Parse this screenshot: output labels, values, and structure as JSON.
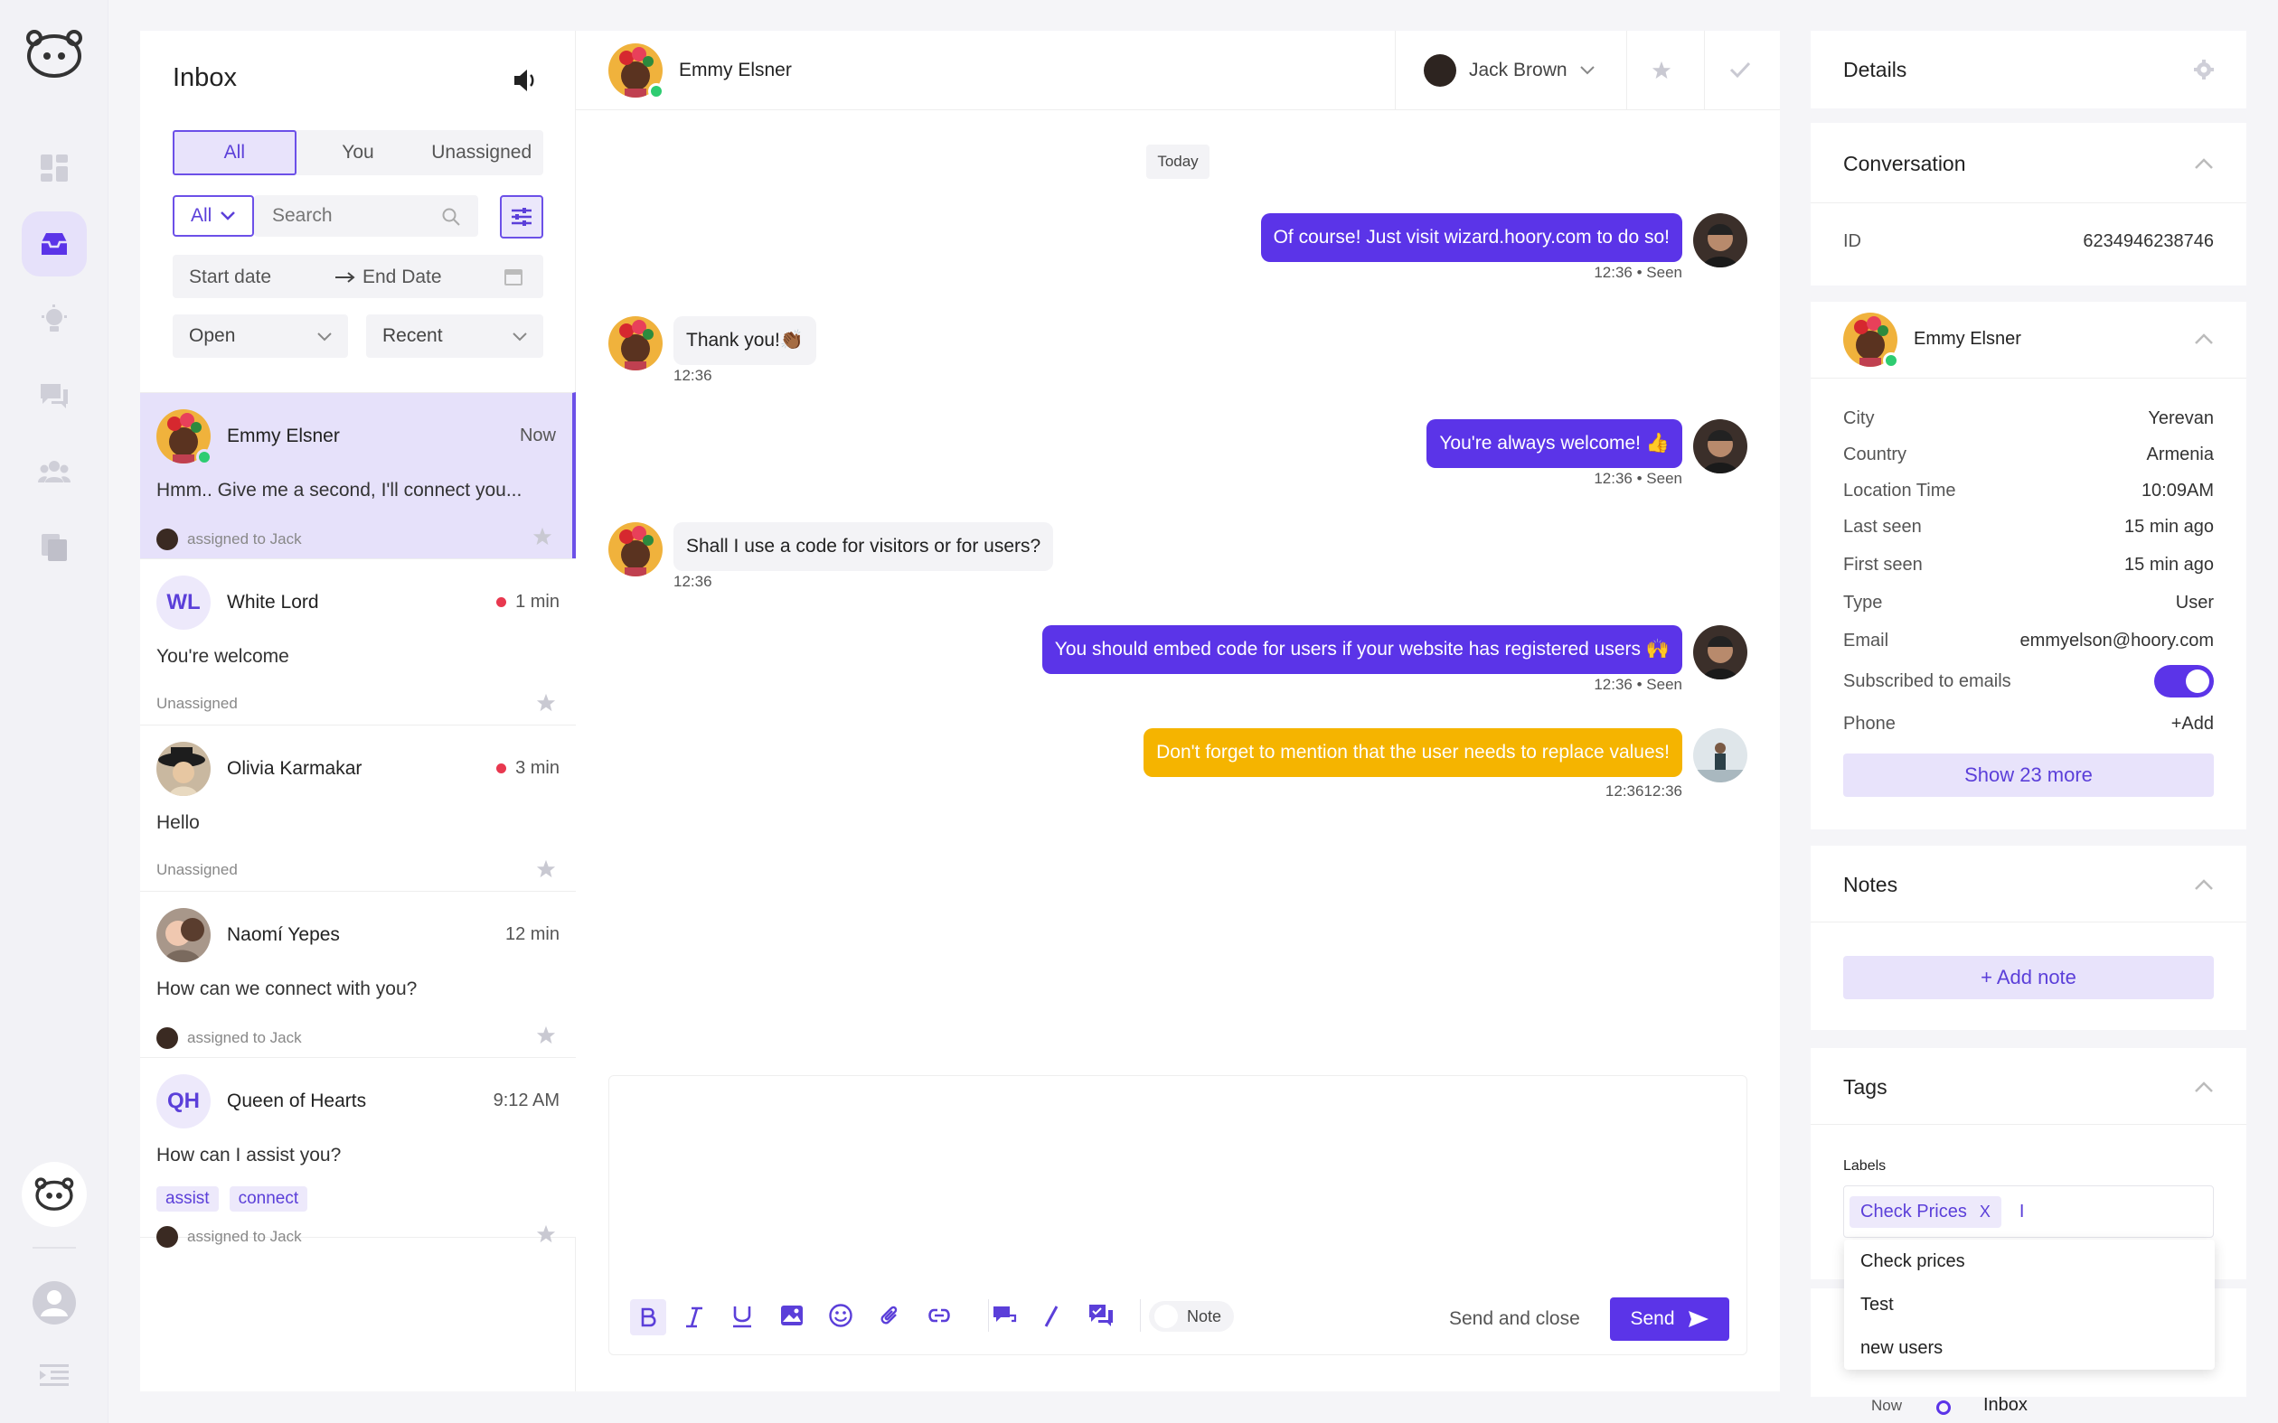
{
  "rail": {
    "logo": "bot-logo-icon",
    "items": [
      "dashboard-icon",
      "inbox-icon",
      "lightbulb-icon",
      "chat-icon",
      "contacts-icon",
      "documents-icon"
    ],
    "bottom": [
      "bot-icon",
      "user-avatar-icon",
      "menu-collapse-icon"
    ]
  },
  "inbox": {
    "title": "Inbox",
    "tabs": [
      "All",
      "You",
      "Unassigned"
    ],
    "filter_select": "All",
    "search_placeholder": "Search",
    "start_date": "Start date",
    "end_date": "End Date",
    "status_select": "Open",
    "sort_select": "Recent",
    "conversations": [
      {
        "name": "Emmy Elsner",
        "time": "Now",
        "message": "Hmm.. Give me a second, I'll connect you...",
        "meta": "assigned to Jack",
        "unread": false
      },
      {
        "name": "White Lord",
        "initials": "WL",
        "time": "1 min",
        "message": "You're welcome",
        "meta": "Unassigned",
        "unread": true
      },
      {
        "name": "Olivia Karmakar",
        "time": "3 min",
        "message": "Hello",
        "meta": "Unassigned",
        "unread": true
      },
      {
        "name": "Naomí Yepes",
        "time": "12 min",
        "message": "How can we connect with you?",
        "meta": "assigned to Jack",
        "unread": false
      },
      {
        "name": "Queen of Hearts",
        "initials": "QH",
        "time": "9:12 AM",
        "message": "How can I assist you?",
        "meta": "assigned to Jack",
        "tags": [
          "assist",
          "connect"
        ],
        "unread": false
      }
    ]
  },
  "chat": {
    "contact_name": "Emmy Elsner",
    "assignee": "Jack Brown",
    "day_separator": "Today",
    "messages": [
      {
        "dir": "out",
        "text": "Of course! Just visit wizard.hoory.com to do so!",
        "stamp": "12:36 • Seen"
      },
      {
        "dir": "in",
        "text": "Thank you!👏🏾",
        "stamp": "12:36"
      },
      {
        "dir": "out",
        "text": "You're always welcome! 👍",
        "stamp": "12:36 • Seen"
      },
      {
        "dir": "in",
        "text": "Shall I use a code for visitors or for users?",
        "stamp": "12:36"
      },
      {
        "dir": "out",
        "text": "You should embed code for users if your website has registered users 🙌",
        "stamp": "12:36 • Seen"
      },
      {
        "dir": "note",
        "text": "Don't forget to mention that the user needs to replace values!",
        "stamp": "12:3612:36"
      }
    ],
    "composer": {
      "note_label": "Note",
      "send_close_label": "Send and close",
      "send_label": "Send"
    }
  },
  "details": {
    "title": "Details",
    "conversation_title": "Conversation",
    "id_label": "ID",
    "id_value": "6234946238746",
    "contact_name": "Emmy Elsner",
    "fields": [
      {
        "k": "City",
        "v": "Yerevan"
      },
      {
        "k": "Country",
        "v": "Armenia"
      },
      {
        "k": "Location Time",
        "v": "10:09AM"
      },
      {
        "k": "Last seen",
        "v": "15 min ago"
      },
      {
        "k": "First seen",
        "v": "15 min ago"
      },
      {
        "k": "Type",
        "v": "User"
      },
      {
        "k": "Email",
        "v": "emmyelson@hoory.com"
      }
    ],
    "subscribed_label": "Subscribed to emails",
    "subscribed": true,
    "phone_label": "Phone",
    "phone_value": "+Add",
    "show_more": "Show 23 more",
    "notes_title": "Notes",
    "add_note": "+ Add note",
    "tags_title": "Tags",
    "labels_label": "Labels",
    "label_chip": "Check Prices",
    "label_chip_remove": "X",
    "label_input_value": "I",
    "suggestions": [
      "Check prices",
      "Test",
      "new users"
    ],
    "footer_time": "Now",
    "footer_inbox": "Inbox"
  },
  "colors": {
    "accent": "#5b34e8",
    "accent_soft": "#e8e3fb",
    "note": "#f5b400",
    "online": "#2ecc71",
    "unread": "#e8384f"
  }
}
